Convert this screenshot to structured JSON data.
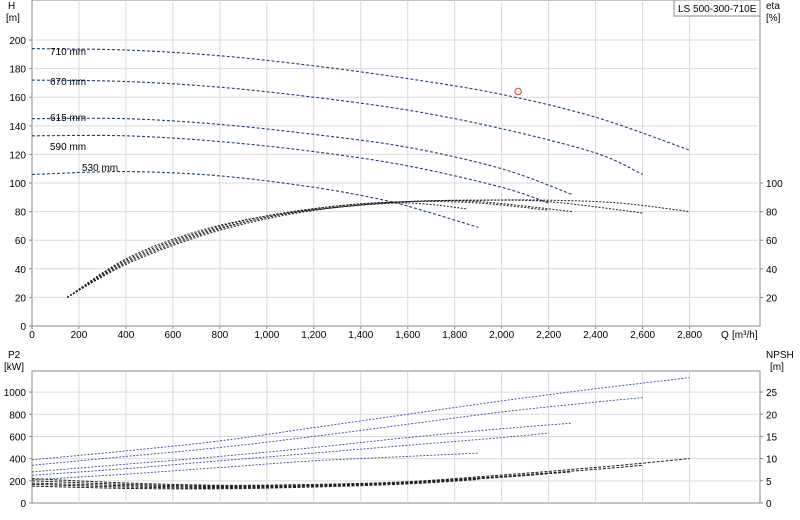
{
  "model_label": "LS 500-300-710E",
  "chart_data": [
    {
      "type": "line",
      "panel": "head-efficiency",
      "ylabel": "H",
      "yunit": "[m]",
      "ylabel2": "eta",
      "yunit2": "[%]",
      "xlabel": "Q",
      "xunit": "[m³/h]",
      "xlim": [
        0,
        3100
      ],
      "ylim": [
        0,
        228
      ],
      "xticks": [
        0,
        200,
        400,
        600,
        800,
        1000,
        1200,
        1400,
        1600,
        1800,
        2000,
        2200,
        2400,
        2600,
        2800
      ],
      "xtick_labels": [
        "0",
        "200",
        "400",
        "600",
        "800",
        "1,000",
        "1,200",
        "1,400",
        "1,600",
        "1,800",
        "2,000",
        "2,200",
        "2,400",
        "2,600",
        "2,800"
      ],
      "yticks": [
        0,
        20,
        40,
        60,
        80,
        100,
        120,
        140,
        160,
        180,
        200
      ],
      "yticks2": [
        20,
        40,
        60,
        80,
        100
      ],
      "grid": true,
      "duty_point": {
        "x": 2070,
        "y": 164
      },
      "head_series": [
        {
          "name": "710 mm",
          "x": [
            0,
            400,
            800,
            1200,
            1600,
            2000,
            2400,
            2800
          ],
          "y": [
            194,
            193,
            189,
            182,
            173,
            162,
            146,
            123
          ]
        },
        {
          "name": "670 mm",
          "x": [
            0,
            400,
            800,
            1200,
            1600,
            2000,
            2400,
            2600
          ],
          "y": [
            172,
            171,
            167,
            160,
            151,
            138,
            121,
            106
          ]
        },
        {
          "name": "615 mm",
          "x": [
            0,
            400,
            800,
            1200,
            1600,
            2000,
            2300
          ],
          "y": [
            145,
            145,
            141,
            134,
            125,
            110,
            92
          ]
        },
        {
          "name": "590 mm",
          "x": [
            0,
            400,
            800,
            1200,
            1600,
            2000,
            2200
          ],
          "y": [
            133,
            133,
            129,
            122,
            112,
            97,
            86
          ]
        },
        {
          "name": "530 mm",
          "x": [
            0,
            400,
            800,
            1200,
            1500,
            1700,
            1900
          ],
          "y": [
            106,
            108,
            105,
            97,
            88,
            79,
            69
          ]
        }
      ],
      "eta_series": [
        {
          "x": [
            150,
            400,
            700,
            1000,
            1300,
            1600,
            1850
          ],
          "y": [
            20,
            47,
            66,
            77,
            83,
            86,
            82
          ]
        },
        {
          "x": [
            150,
            400,
            700,
            1000,
            1300,
            1600,
            1900,
            2200
          ],
          "y": [
            20,
            46,
            65,
            77,
            84,
            87,
            86,
            81
          ]
        },
        {
          "x": [
            150,
            400,
            700,
            1000,
            1300,
            1600,
            1900,
            2300
          ],
          "y": [
            20,
            45,
            64,
            76,
            84,
            87,
            87,
            80
          ]
        },
        {
          "x": [
            150,
            400,
            700,
            1000,
            1300,
            1600,
            1900,
            2200,
            2600
          ],
          "y": [
            20,
            44,
            63,
            76,
            83,
            87,
            88,
            87,
            79
          ]
        },
        {
          "x": [
            150,
            400,
            700,
            1000,
            1300,
            1600,
            1900,
            2200,
            2500,
            2800
          ],
          "y": [
            20,
            43,
            62,
            75,
            83,
            87,
            88,
            88,
            86,
            80
          ]
        }
      ]
    },
    {
      "type": "line",
      "panel": "power-npsh",
      "ylabel": "P2",
      "yunit": "[kW]",
      "ylabel2": "NPSH",
      "yunit2": "[m]",
      "xlim": [
        0,
        3100
      ],
      "ylim": [
        0,
        1190
      ],
      "yticks": [
        0,
        200,
        400,
        600,
        800,
        1000
      ],
      "npsh_scale_per_m": 40,
      "yticks2": [
        0,
        5,
        10,
        15,
        20,
        25
      ],
      "grid": true,
      "power_series": [
        {
          "x": [
            0,
            400,
            800,
            1200,
            1600,
            2000,
            2400,
            2800
          ],
          "y": [
            390,
            470,
            560,
            680,
            800,
            920,
            1030,
            1130
          ]
        },
        {
          "x": [
            0,
            400,
            800,
            1200,
            1600,
            2000,
            2400,
            2600
          ],
          "y": [
            340,
            420,
            500,
            600,
            710,
            820,
            910,
            950
          ]
        },
        {
          "x": [
            0,
            400,
            800,
            1200,
            1600,
            2000,
            2300
          ],
          "y": [
            280,
            350,
            420,
            500,
            590,
            670,
            720
          ]
        },
        {
          "x": [
            0,
            400,
            800,
            1200,
            1600,
            2000,
            2200
          ],
          "y": [
            250,
            310,
            380,
            450,
            520,
            590,
            630
          ]
        },
        {
          "x": [
            0,
            400,
            800,
            1200,
            1600,
            1900
          ],
          "y": [
            210,
            260,
            320,
            380,
            420,
            450
          ]
        }
      ],
      "npsh_series": [
        {
          "x": [
            0,
            400,
            800,
            1200,
            1600,
            2000,
            2400,
            2800
          ],
          "y": [
            5.5,
            4.5,
            4.0,
            4.2,
            4.8,
            6.3,
            8.0,
            10.0
          ]
        },
        {
          "x": [
            0,
            400,
            800,
            1200,
            1600,
            2000,
            2400,
            2600
          ],
          "y": [
            5.0,
            4.2,
            3.8,
            4.0,
            4.7,
            6.0,
            7.6,
            8.5
          ]
        },
        {
          "x": [
            0,
            400,
            800,
            1200,
            1600,
            2000,
            2300
          ],
          "y": [
            4.5,
            3.9,
            3.6,
            3.9,
            4.6,
            5.9,
            7.0
          ]
        },
        {
          "x": [
            0,
            400,
            800,
            1200,
            1600,
            2000,
            2200
          ],
          "y": [
            4.2,
            3.6,
            3.4,
            3.8,
            4.5,
            5.8,
            6.6
          ]
        },
        {
          "x": [
            0,
            400,
            800,
            1200,
            1600,
            1900
          ],
          "y": [
            3.8,
            3.3,
            3.2,
            3.6,
            4.3,
            5.3
          ]
        }
      ]
    }
  ]
}
